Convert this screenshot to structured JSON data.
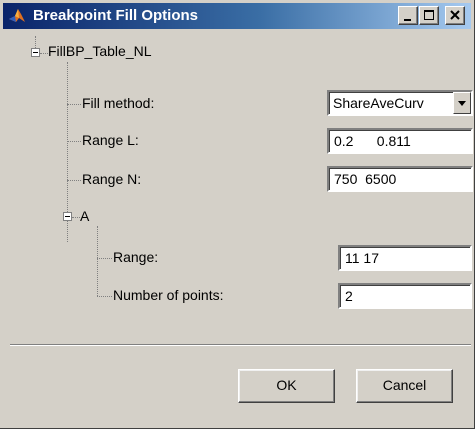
{
  "window": {
    "title": "Breakpoint Fill Options"
  },
  "tree": {
    "root_label": "FillBP_Table_NL",
    "fill_method": {
      "label": "Fill method:",
      "selected": "ShareAveCurv"
    },
    "range_l": {
      "label": "Range L:",
      "value": "0.2      0.811"
    },
    "range_n": {
      "label": "Range N:",
      "value": "750  6500"
    },
    "node_a": {
      "label": "A",
      "range": {
        "label": "Range:",
        "value": "11 17"
      },
      "num_points": {
        "label": "Number of points:",
        "value": "2"
      }
    }
  },
  "buttons": {
    "ok": "OK",
    "cancel": "Cancel"
  }
}
